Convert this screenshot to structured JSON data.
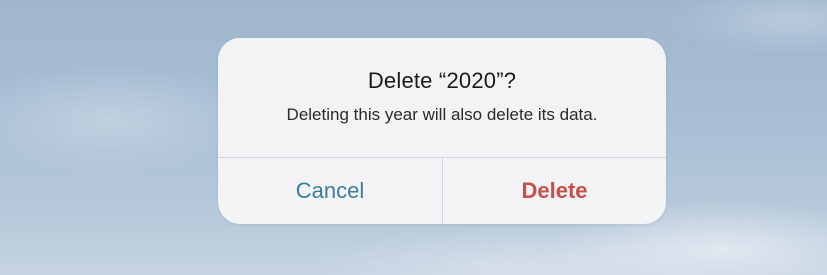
{
  "alert": {
    "title": "Delete “2020”?",
    "message": "Deleting this year will also delete its data.",
    "buttons": {
      "cancel_label": "Cancel",
      "delete_label": "Delete"
    }
  },
  "colors": {
    "cancel": "#3e7d98",
    "destructive": "#c6504b",
    "alert_background": "#f5f5f6",
    "sky": "#a9bfd4"
  }
}
